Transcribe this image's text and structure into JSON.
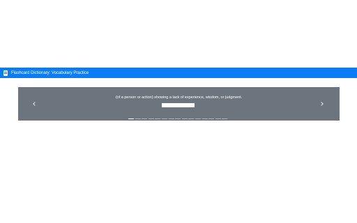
{
  "app": {
    "title": "Flashcard Dictionary: Vocabulary Practice",
    "icon": "document-icon",
    "titlebar_color": "#0a7cf5"
  },
  "carousel": {
    "background_color": "#6c757d",
    "definition": "(of a person or action) showing a lack of experience, wisdom, or judgment.",
    "answer_value": "",
    "prev_icon": "chevron-left-icon",
    "next_icon": "chevron-right-icon",
    "slide_count": 15,
    "active_slide": 1
  }
}
